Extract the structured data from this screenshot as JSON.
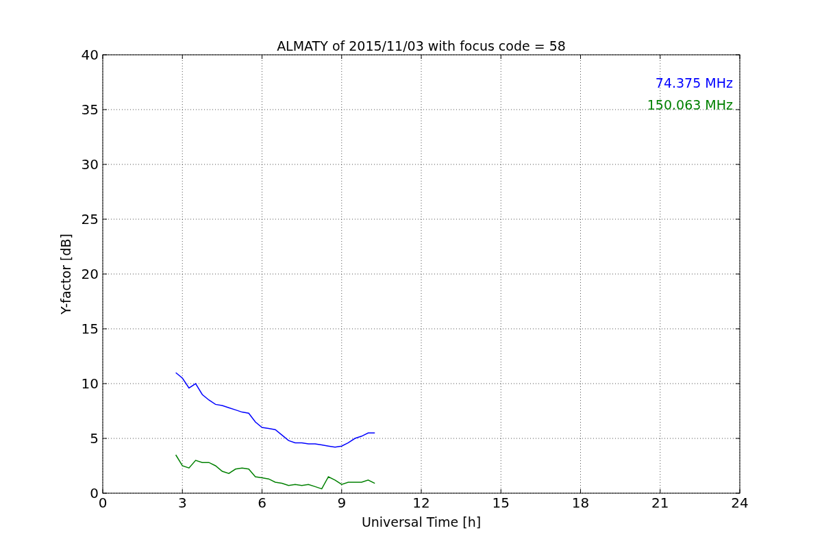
{
  "chart_data": {
    "type": "line",
    "title": "ALMATY of 2015/11/03 with focus code = 58",
    "xlabel": "Universal Time [h]",
    "ylabel": "Y-factor [dB]",
    "x": [
      2.75,
      3,
      3.25,
      3.5,
      3.75,
      4,
      4.25,
      4.5,
      4.75,
      5,
      5.25,
      5.5,
      5.75,
      6,
      6.25,
      6.5,
      6.75,
      7,
      7.25,
      7.5,
      7.75,
      8,
      8.25,
      8.5,
      8.75,
      9,
      9.25,
      9.5,
      9.75,
      10,
      10.25
    ],
    "series": [
      {
        "name": "74.375 MHz",
        "color": "#0000ff",
        "values": [
          11,
          10.5,
          9.6,
          10,
          9,
          8.5,
          8.1,
          8,
          7.8,
          7.6,
          7.4,
          7.3,
          6.5,
          6,
          5.9,
          5.8,
          5.3,
          4.8,
          4.6,
          4.6,
          4.5,
          4.5,
          4.4,
          4.3,
          4.2,
          4.3,
          4.6,
          5,
          5.2,
          5.5,
          5.5
        ]
      },
      {
        "name": "150.063 MHz",
        "color": "#008000",
        "values": [
          3.5,
          2.5,
          2.3,
          3,
          2.8,
          2.8,
          2.5,
          2,
          1.8,
          2.2,
          2.3,
          2.2,
          1.5,
          1.4,
          1.3,
          1,
          0.9,
          0.7,
          0.8,
          0.7,
          0.8,
          0.6,
          0.4,
          1.5,
          1.2,
          0.8,
          1,
          1,
          1,
          1.2,
          0.9
        ]
      }
    ],
    "grid": true,
    "xlim": [
      0,
      24
    ],
    "ylim": [
      0,
      40
    ],
    "xticks": [
      0,
      3,
      6,
      9,
      12,
      15,
      18,
      21,
      24
    ],
    "yticks": [
      0,
      5,
      10,
      15,
      20,
      25,
      30,
      35,
      40
    ]
  }
}
